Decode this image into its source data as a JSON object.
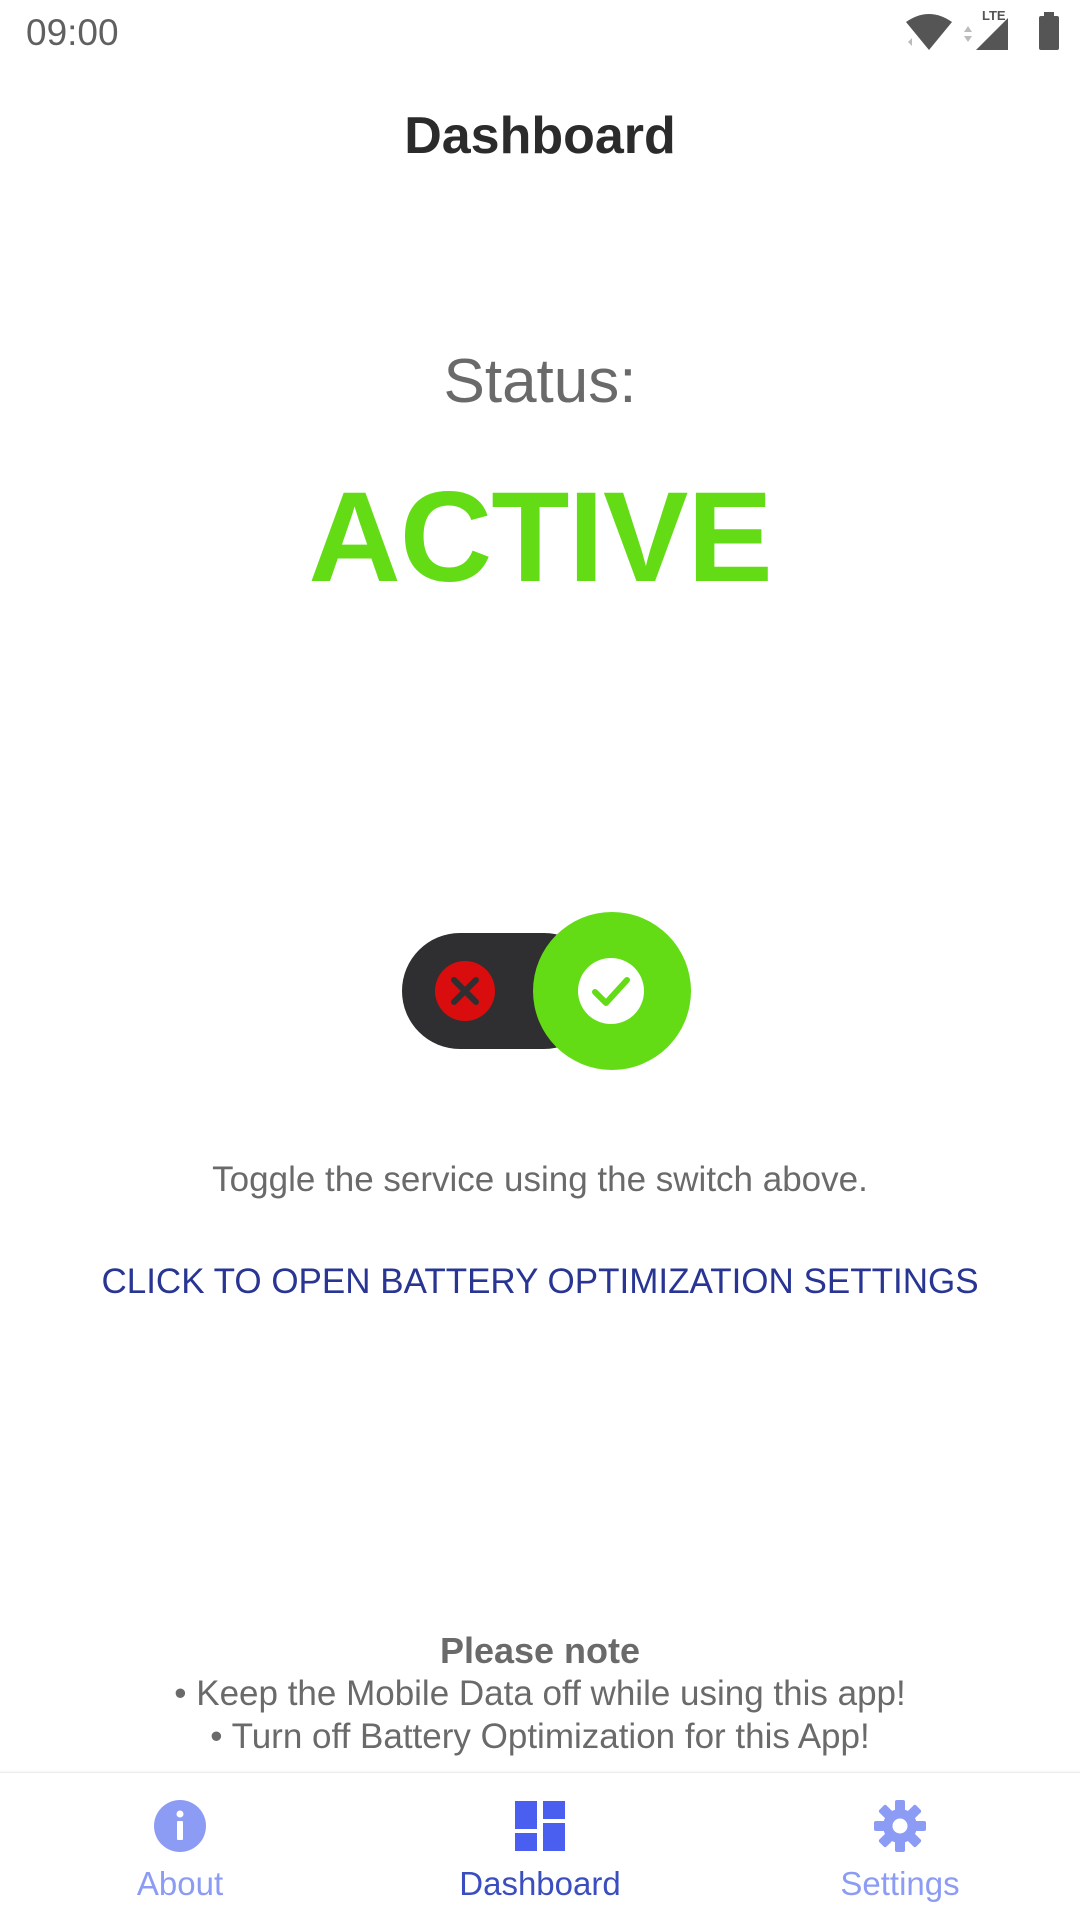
{
  "status_bar": {
    "time": "09:00",
    "network_label": "LTE",
    "icons": [
      "wifi-icon",
      "cellular-signal-icon",
      "battery-icon"
    ]
  },
  "header": {
    "title": "Dashboard"
  },
  "main": {
    "status_label": "Status:",
    "status_value": "ACTIVE",
    "status_color": "#63dc16",
    "toggle": {
      "state": "on",
      "on_color": "#63dc16",
      "off_icon": "close-icon",
      "on_icon": "check-icon"
    },
    "hint": "Toggle the service using the switch above.",
    "battery_link": "CLICK TO OPEN BATTERY OPTIMIZATION SETTINGS"
  },
  "note": {
    "title": "Please note",
    "lines": [
      "• Keep the Mobile Data off while using this app!",
      "• Turn off Battery Optimization for this App!"
    ]
  },
  "bottom_nav": {
    "items": [
      {
        "label": "About",
        "icon": "info-icon",
        "active": false
      },
      {
        "label": "Dashboard",
        "icon": "dashboard-icon",
        "active": true
      },
      {
        "label": "Settings",
        "icon": "gear-icon",
        "active": false
      }
    ],
    "active_color": "#3b4ec0",
    "inactive_color": "#8c9cf5"
  }
}
